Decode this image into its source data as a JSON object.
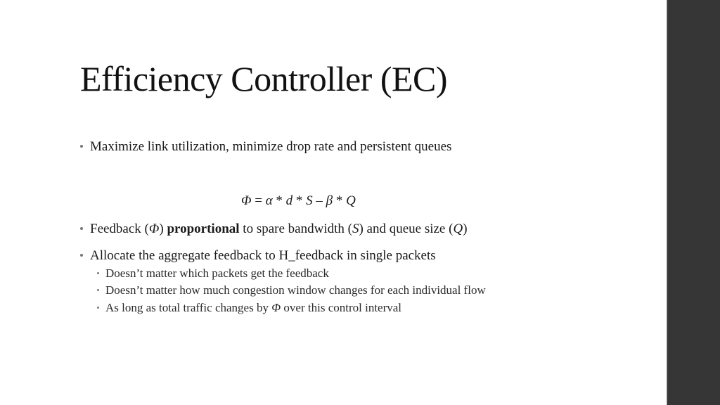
{
  "slide": {
    "title": "Efficiency Controller (EC)",
    "bullet1": "Maximize link utilization, minimize drop rate and persistent queues",
    "formula": {
      "phi": "Φ",
      "eq": " = ",
      "alpha": "α",
      "star1": " * ",
      "d": "d",
      "star2": " * ",
      "S": "S",
      "minus": " – ",
      "beta": "β",
      "star3": " * ",
      "Q": "Q"
    },
    "bullet2": {
      "pre": "Feedback (",
      "phi": "Φ",
      "mid1": ") ",
      "bold": "proportional",
      "mid2": " to spare bandwidth (",
      "S": "S",
      "mid3": ") and queue size (",
      "Q": "Q",
      "post": ")"
    },
    "bullet3": "Allocate the aggregate feedback to H_feedback in single packets",
    "sub_bullets": [
      "Doesn’t matter which packets get the feedback",
      "Doesn’t matter how much congestion window changes for each individual flow"
    ],
    "sub_bullet3": {
      "pre": "As long as total traffic changes by ",
      "phi": "Φ",
      "post": " over this control interval"
    }
  },
  "colors": {
    "sidebar": "#363636",
    "background": "#ffffff",
    "text": "#1a1a1a"
  }
}
